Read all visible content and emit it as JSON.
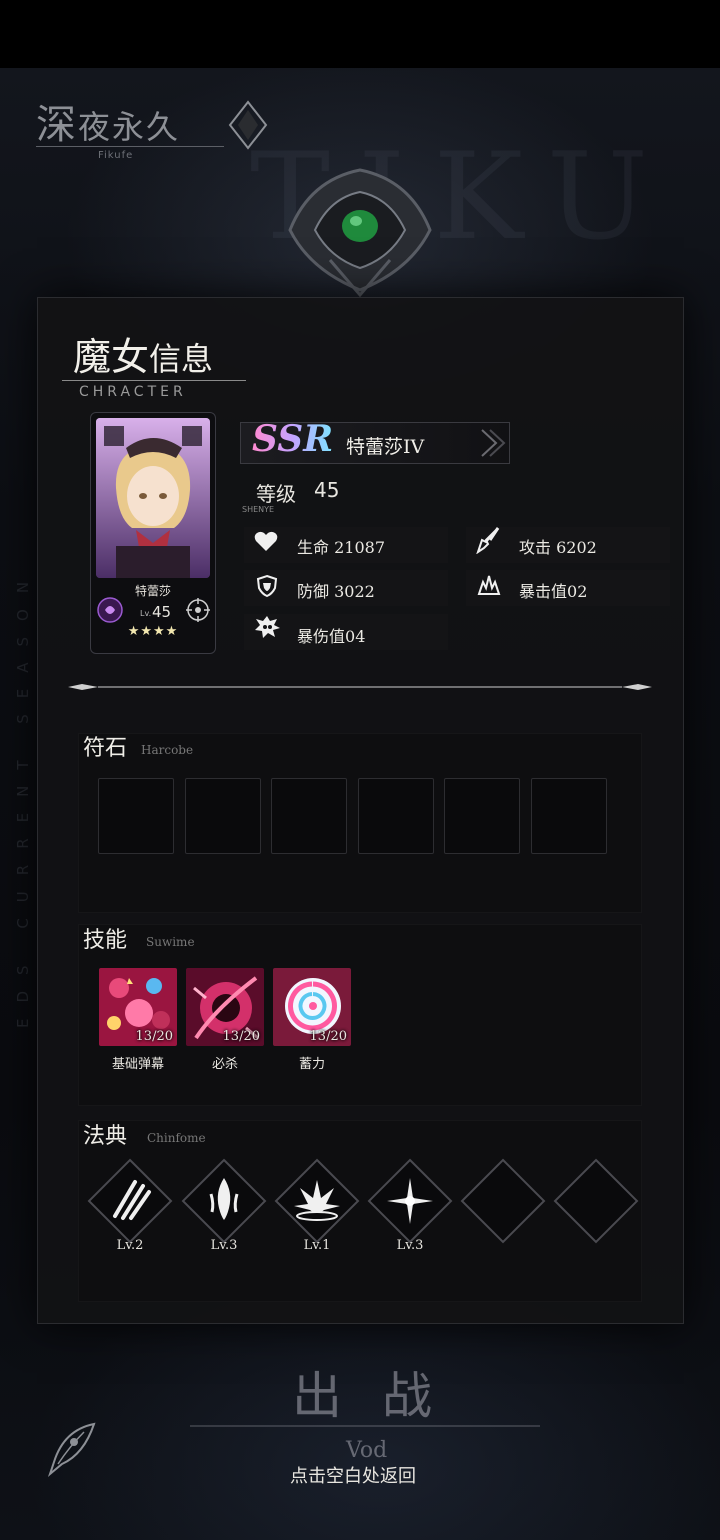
{
  "header": {
    "logo_title_1": "深",
    "logo_title_2": "夜永久",
    "logo_subtitle": "Fikufe",
    "bg_letters": "TIKU",
    "season_vertical": "EDS CURRENT SEASON"
  },
  "panel": {
    "title_1": "魔女",
    "title_2": "信息",
    "subtitle": "CHRACTER"
  },
  "card": {
    "name": "特蕾莎",
    "lv_label": "Lv.",
    "level": "45",
    "stars": "★★★★"
  },
  "character": {
    "rarity": "SSR",
    "name": "特蕾莎IV",
    "level_label": "等级",
    "level_value": "45",
    "tag": "SHENYE"
  },
  "stats": {
    "hp_label": "生命",
    "hp_value": "21087",
    "atk_label": "攻击",
    "atk_value": "6202",
    "def_label": "防御",
    "def_value": "3022",
    "crit_label": "暴击值",
    "crit_value": "02",
    "critdmg_label": "暴伤值",
    "critdmg_value": "04"
  },
  "runes": {
    "title": "符石",
    "subtitle": "Harcobe",
    "slot_count": 6
  },
  "skills": {
    "title": "技能",
    "subtitle": "Suwime",
    "items": [
      {
        "label": "基础弹幕",
        "count": "13/20"
      },
      {
        "label": "必杀",
        "count": "13/20"
      },
      {
        "label": "蓄力",
        "count": "13/20"
      }
    ]
  },
  "codex": {
    "title": "法典",
    "subtitle": "Chinfome",
    "items": [
      {
        "label": "Lv.2",
        "icon": "slash-claw-icon"
      },
      {
        "label": "Lv.3",
        "icon": "flame-burst-icon"
      },
      {
        "label": "Lv.1",
        "icon": "splash-impact-icon"
      },
      {
        "label": "Lv.3",
        "icon": "starburst-icon"
      },
      {
        "label": "",
        "icon": "empty"
      },
      {
        "label": "",
        "icon": "empty"
      }
    ]
  },
  "footer": {
    "deploy": "出战",
    "vod": "Vod",
    "back_hint": "点击空白处返回"
  },
  "colors": {
    "panel_bg": "#121214",
    "text": "#e8e6e0",
    "rarity_gradient": [
      "#ff8ad0",
      "#c4a3ff",
      "#7ee3ff"
    ],
    "emblem_gem": "#1f8a3c"
  }
}
